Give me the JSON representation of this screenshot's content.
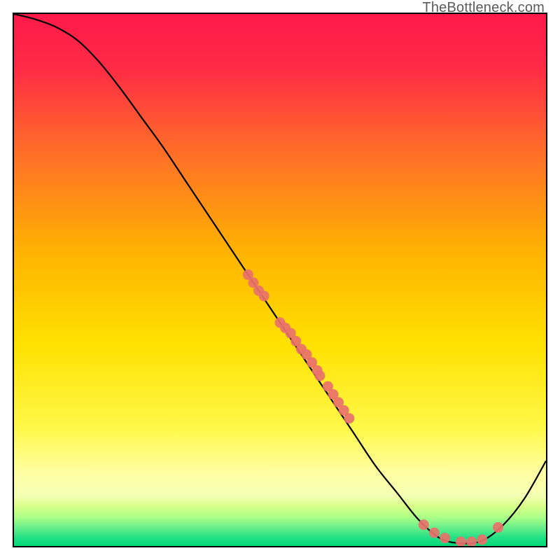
{
  "attribution": "TheBottleneck.com",
  "chart_data": {
    "type": "line",
    "title": "",
    "xlabel": "",
    "ylabel": "",
    "xlim": [
      0,
      100
    ],
    "ylim": [
      0,
      100
    ],
    "grid": false,
    "legend": false,
    "gradient_colors": {
      "top": "#ff1a4a",
      "upper_mid": "#ffde00",
      "lower_mid": "#ffff6a",
      "band": "#d8ff7a",
      "bottom": "#00e07a"
    },
    "series": [
      {
        "name": "curve",
        "type": "line",
        "color": "#000000",
        "x": [
          0,
          4,
          8,
          12,
          16,
          20,
          24,
          28,
          32,
          36,
          40,
          44,
          48,
          52,
          56,
          60,
          64,
          68,
          72,
          76,
          80,
          84,
          88,
          92,
          96,
          100
        ],
        "y": [
          100,
          99,
          97.5,
          95,
          91,
          86,
          80.5,
          75,
          69,
          63,
          57,
          51,
          45,
          39,
          33,
          27,
          21,
          15,
          10,
          5,
          1.5,
          0.5,
          1,
          4,
          9,
          16
        ]
      },
      {
        "name": "points",
        "type": "scatter",
        "color": "#e9716b",
        "x": [
          44,
          45,
          46,
          47,
          50,
          51,
          52,
          53,
          54,
          55,
          56,
          57,
          57.5,
          59,
          60,
          61,
          62,
          63,
          77,
          79,
          81,
          84,
          86,
          88,
          91
        ],
        "y": [
          51,
          49.5,
          48,
          47,
          42,
          41,
          40,
          38.5,
          37,
          36,
          34.5,
          33,
          32,
          30,
          28.5,
          27,
          25.5,
          24,
          4,
          2.5,
          1.5,
          0.8,
          0.8,
          1.2,
          3.5
        ]
      }
    ]
  }
}
